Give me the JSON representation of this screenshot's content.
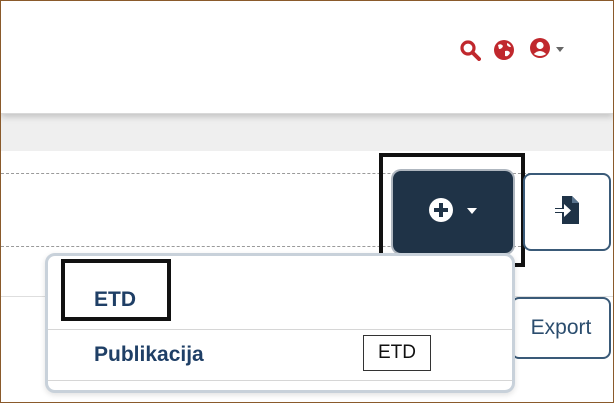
{
  "header": {
    "icons": [
      "search-icon",
      "globe-icon",
      "user-icon",
      "caret-down-icon"
    ],
    "accent_color": "#c0282d"
  },
  "toolbar": {
    "add_button_icons": [
      "plus-circle-icon",
      "caret-down-icon"
    ],
    "import_button_icon": "file-import-icon",
    "export_label": "Export",
    "primary_color": "#1f3347"
  },
  "dropdown": {
    "items": [
      {
        "label": "ETD"
      },
      {
        "label": "Publikacija"
      }
    ]
  },
  "tooltip": {
    "text": "ETD"
  }
}
